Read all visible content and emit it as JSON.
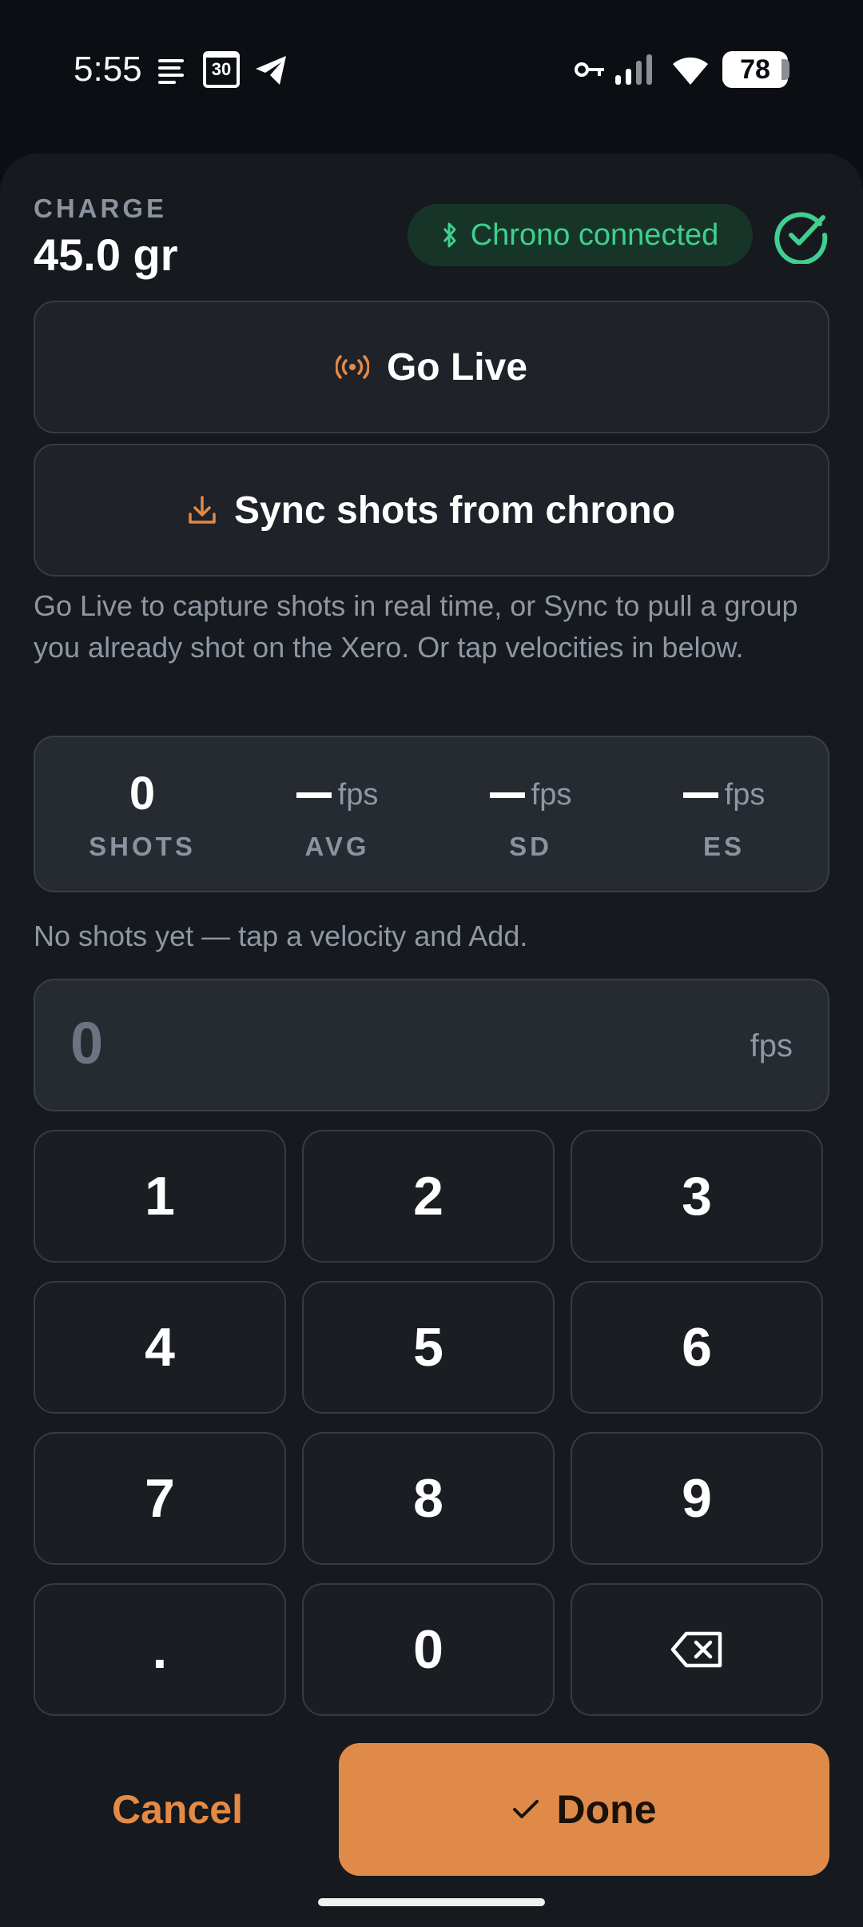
{
  "status_bar": {
    "time": "5:55",
    "calendar_day": "30",
    "battery": "78"
  },
  "charge": {
    "label": "CHARGE",
    "value": "45.0 gr"
  },
  "chrono": {
    "status_label": "Chrono connected"
  },
  "actions": {
    "go_live_label": "Go Live",
    "sync_label": "Sync shots from chrono",
    "helper_text": "Go Live to capture shots in real time, or Sync to pull a group you already shot on the Xero. Or tap velocities in below."
  },
  "stats": [
    {
      "value": "0",
      "unit": "",
      "label": "SHOTS"
    },
    {
      "value": "—",
      "unit": "fps",
      "label": "AVG"
    },
    {
      "value": "—",
      "unit": "fps",
      "label": "SD"
    },
    {
      "value": "—",
      "unit": "fps",
      "label": "ES"
    }
  ],
  "empty_message": "No shots yet — tap a velocity and Add.",
  "velocity_input": {
    "value": "0",
    "unit": "fps"
  },
  "keypad": [
    "1",
    "2",
    "3",
    "4",
    "5",
    "6",
    "7",
    "8",
    "9",
    ".",
    "0"
  ],
  "footer": {
    "cancel_label": "Cancel",
    "done_label": "Done"
  },
  "colors": {
    "accent": "#e08a4a",
    "success": "#3fcf8e",
    "background": "#16191e"
  }
}
